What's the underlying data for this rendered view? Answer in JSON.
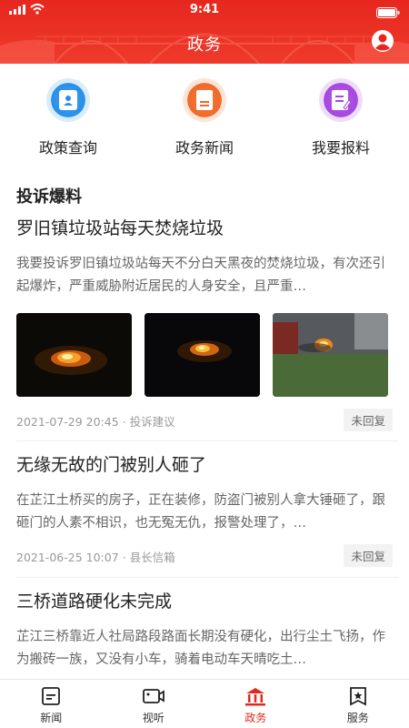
{
  "status": {
    "time": "9:41"
  },
  "header": {
    "title": "政务"
  },
  "actions": [
    {
      "label": "政策查询"
    },
    {
      "label": "政务新闻"
    },
    {
      "label": "我要报料"
    }
  ],
  "section": {
    "title": "投诉爆料"
  },
  "posts": [
    {
      "title": "罗旧镇垃圾站每天焚烧垃圾",
      "body": "我要投诉罗旧镇垃圾站每天不分白天黑夜的焚烧垃圾，有次还引起爆炸，严重威胁附近居民的人身安全，且严重…",
      "date": "2021-07-29 20:45",
      "category": "投诉建议",
      "status": "未回复"
    },
    {
      "title": "无缘无故的门被别人砸了",
      "body": "在芷江土桥买的房子，正在装修，防盗门被别人拿大锤砸了，跟砸门的人素不相识，也无冤无仇，报警处理了，…",
      "date": "2021-06-25 10:07",
      "category": "县长信箱",
      "status": "未回复"
    },
    {
      "title": "三桥道路硬化未完成",
      "body": "芷江三桥靠近人社局路段路面长期没有硬化，出行尘土飞扬，作为搬砖一族，又没有小车，骑着电动车天晴吃土…"
    }
  ],
  "tabs": [
    {
      "label": "新闻"
    },
    {
      "label": "视听"
    },
    {
      "label": "政务"
    },
    {
      "label": "服务"
    }
  ],
  "colors": {
    "brand": "#e7271f",
    "muted": "#999999"
  }
}
